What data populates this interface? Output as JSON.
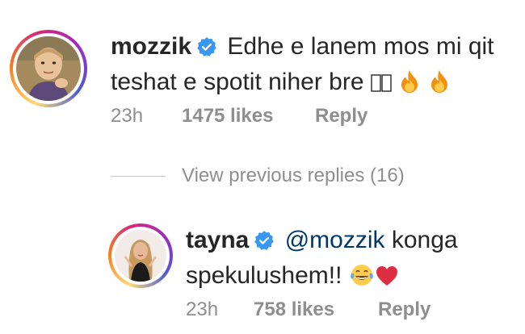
{
  "comments": [
    {
      "username": "mozzik",
      "verified": true,
      "text_line1": "Edhe e lanem mos mi qit",
      "text_line2": "teshat e spotit niher bre",
      "trailing_emoji": [
        "missing-glyph-icon",
        "missing-glyph-icon",
        "fire-emoji",
        "fire-emoji"
      ],
      "time": "23h",
      "likes": "1475 likes",
      "reply_label": "Reply"
    }
  ],
  "view_replies": {
    "label": "View previous replies (16)"
  },
  "reply": {
    "username": "tayna",
    "verified": true,
    "mention": "@mozzik",
    "text_line1_rest": " konga",
    "text_line2": "spekulushem!!",
    "trailing_emoji": [
      "tears-of-joy-emoji",
      "red-heart-emoji"
    ],
    "time": "23h",
    "likes": "758 likes",
    "reply_label": "Reply"
  },
  "colors": {
    "text": "#262626",
    "meta": "#8e8e8e",
    "mention": "#00376b",
    "verified": "#3897f0"
  }
}
